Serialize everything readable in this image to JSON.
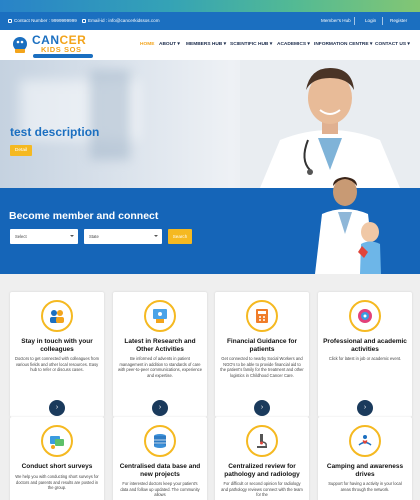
{
  "topbar": {
    "contact": "Contact Number : 9999999999",
    "email": "Email-id : info@cancerkidssos.com",
    "members_hub": "Member's Hub",
    "login": "Login",
    "register": "Register"
  },
  "logo": {
    "line1a": "CAN",
    "line1b": "CER",
    "line2": "KIDS SOS"
  },
  "nav": [
    "HOME",
    "ABOUT ▾",
    "MEMBERS HUB ▾",
    "SCIENTIFIC HUB ▾",
    "ACADEMICS ▾",
    "INFORMATION CENTRE ▾",
    "CONTACT US ▾"
  ],
  "hero": {
    "title": "test description",
    "button": "Detail"
  },
  "member": {
    "title": "Become member and connect",
    "select1": "Select",
    "select2": "State",
    "search": "Search"
  },
  "cards": [
    {
      "title": "Stay in touch with your colleagues",
      "text": "Doctors to get connected with colleagues from various fields and other local resources. Easy hub to refer or discuss cases.",
      "icon": "colleagues-icon"
    },
    {
      "title": "Latest in Research and Other Activities",
      "text": "Be informed of advents in patient management in addition to standards of care with peer-to-peer communications, experience and expertise.",
      "icon": "research-icon"
    },
    {
      "title": "Financial Guidance for patients",
      "text": "Get connected to nearby Social Workers and NGO's to be able to provide financial aid to the patient's family for the treatment and other logistics in Childhood Cancer Care.",
      "icon": "finance-icon"
    },
    {
      "title": "Professional and academic activities",
      "text": "Click for latest in job or academic event.",
      "icon": "academic-icon"
    },
    {
      "title": "Conduct short surveys",
      "text": "We help you with conducting short surveys for doctors and parents and results are posted in the group.",
      "icon": "survey-icon"
    },
    {
      "title": "Centralised data base and new projects",
      "text": "For interested doctors keep your patient's data and follow up updated. The community allows",
      "icon": "database-icon"
    },
    {
      "title": "Centralized review for pathology and radiology",
      "text": "For difficult or second opinion for radiology and pathology reviews connect with the team for the",
      "icon": "microscope-icon"
    },
    {
      "title": "Camping and awareness drives",
      "text": "Support for having a activity in your local areas through the network.",
      "icon": "awareness-icon"
    }
  ],
  "colors": {
    "primary": "#1565b8",
    "accent": "#f5b921",
    "dark": "#1a3a5c"
  }
}
